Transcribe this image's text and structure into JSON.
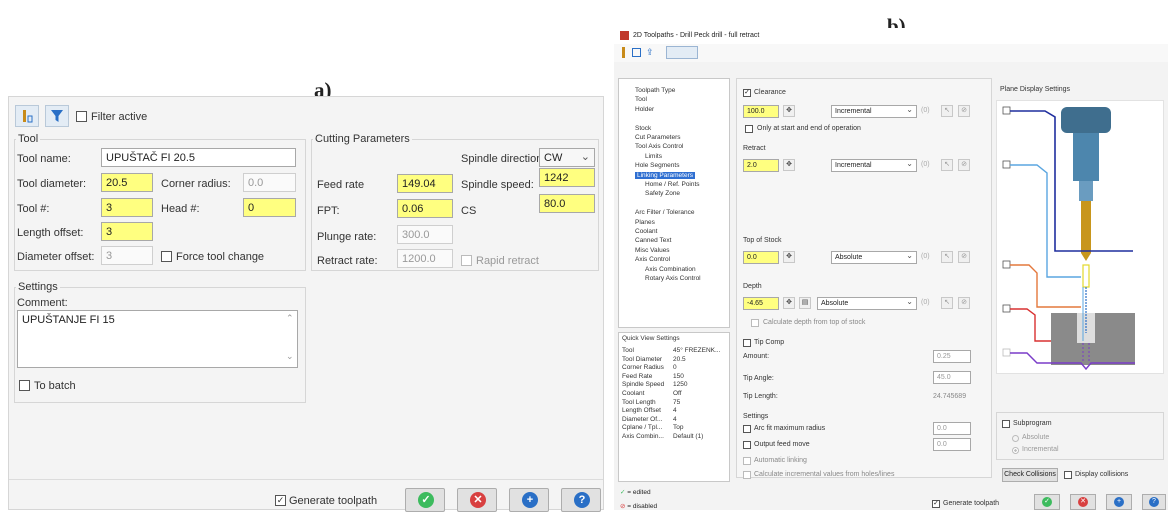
{
  "labels": {
    "a": "a)",
    "b": "b)"
  },
  "panel_a": {
    "toolbar": {
      "filter_active": "Filter active"
    },
    "tool": {
      "group_title": "Tool",
      "tool_name_label": "Tool name:",
      "tool_name_value": "UPUŠTAČ FI 20.5",
      "tool_diameter_label": "Tool diameter:",
      "tool_diameter_value": "20.5",
      "corner_radius_label": "Corner radius:",
      "corner_radius_value": "0.0",
      "tool_num_label": "Tool #:",
      "tool_num_value": "3",
      "head_num_label": "Head #:",
      "head_num_value": "0",
      "length_offset_label": "Length offset:",
      "length_offset_value": "3",
      "diameter_offset_label": "Diameter offset:",
      "diameter_offset_value": "3",
      "force_tool_change": "Force tool change"
    },
    "cutting": {
      "group_title": "Cutting Parameters",
      "spindle_direction_label": "Spindle direction:",
      "spindle_direction_value": "CW",
      "feed_rate_label": "Feed rate",
      "feed_rate_value": "149.04",
      "spindle_speed_label": "Spindle speed:",
      "spindle_speed_value": "1242",
      "fpt_label": "FPT:",
      "fpt_value": "0.06",
      "cs_label": "CS",
      "cs_value": "80.0",
      "plunge_rate_label": "Plunge rate:",
      "plunge_rate_value": "300.0",
      "retract_rate_label": "Retract rate:",
      "retract_rate_value": "1200.0",
      "rapid_retract": "Rapid retract"
    },
    "settings": {
      "group_title": "Settings",
      "comment_label": "Comment:",
      "comment_value": "UPUŠTANJE FI 15",
      "to_batch": "To batch"
    },
    "footer": {
      "generate_toolpath": "Generate toolpath"
    }
  },
  "panel_b": {
    "title": "2D Toolpaths - Drill Peck drill - full retract",
    "tree": [
      "Toolpath Type",
      "Tool",
      "Holder",
      "",
      "Stock",
      "Cut Parameters",
      "Tool Axis Control",
      "Limits",
      "Hole Segments",
      "Linking Parameters",
      "Home / Ref. Points",
      "Safety Zone",
      "",
      "Arc Filter / Tolerance",
      "Planes",
      "Coolant",
      "Canned Text",
      "Misc Values",
      "Axis Control",
      "Axis Combination",
      "Rotary Axis Control"
    ],
    "quick_view": {
      "title": "Quick View Settings",
      "rows": [
        [
          "Tool",
          "45° FREZENK..."
        ],
        [
          "Tool Diameter",
          "20.5"
        ],
        [
          "Corner Radius",
          "0"
        ],
        [
          "Feed Rate",
          "150"
        ],
        [
          "Spindle Speed",
          "1250"
        ],
        [
          "Coolant",
          "Off"
        ],
        [
          "Tool Length",
          "75"
        ],
        [
          "Length Offset",
          "4"
        ],
        [
          "Diameter Of...",
          "4"
        ],
        [
          "Cplane / Tpl...",
          "Top"
        ],
        [
          "Axis Combin...",
          "Default (1)"
        ]
      ]
    },
    "legend": {
      "edited": "= edited",
      "disabled": "= disabled"
    },
    "clearance": {
      "label": "Clearance",
      "value": "100.0",
      "mode": "Incremental",
      "zero": "(0)",
      "only_start_end": "Only at start and end of operation"
    },
    "retract": {
      "label": "Retract",
      "value": "2.0",
      "mode": "Incremental",
      "zero": "(0)"
    },
    "top_of_stock": {
      "label": "Top of Stock",
      "value": "0.0",
      "mode": "Absolute",
      "zero": "(0)"
    },
    "depth": {
      "label": "Depth",
      "value": "-4.65",
      "mode": "Absolute",
      "zero": "(0)",
      "calc_depth": "Calculate depth from top of stock"
    },
    "tip_comp": {
      "label": "Tip Comp",
      "amount_label": "Amount:",
      "amount_value": "0.25",
      "tip_angle_label": "Tip Angle:",
      "tip_angle_value": "45.0",
      "tip_length_label": "Tip Length:",
      "tip_length_value": "24.745689"
    },
    "plane_display": {
      "title": "Plane Display Settings"
    },
    "settings": {
      "title": "Settings",
      "arc_fit": "Arc fit maximum radius",
      "arc_fit_value": "0.0",
      "output_feed": "Output feed move",
      "output_feed_value": "0.0",
      "automatic_linking": "Automatic linking",
      "calc_incremental": "Calculate incremental values from holes/lines"
    },
    "subprogram": {
      "label": "Subprogram",
      "absolute": "Absolute",
      "incremental": "Incremental"
    },
    "check_collisions": "Check Collisions",
    "display_collisions": "Display collisions",
    "generate_toolpath": "Generate toolpath"
  },
  "colors": {
    "ok": "#3dbb5e",
    "cancel": "#d84040",
    "add": "#2a6fc6",
    "help": "#2a6fc6",
    "highlight": "#ffff80",
    "tree_select": "#2f6fd1"
  }
}
